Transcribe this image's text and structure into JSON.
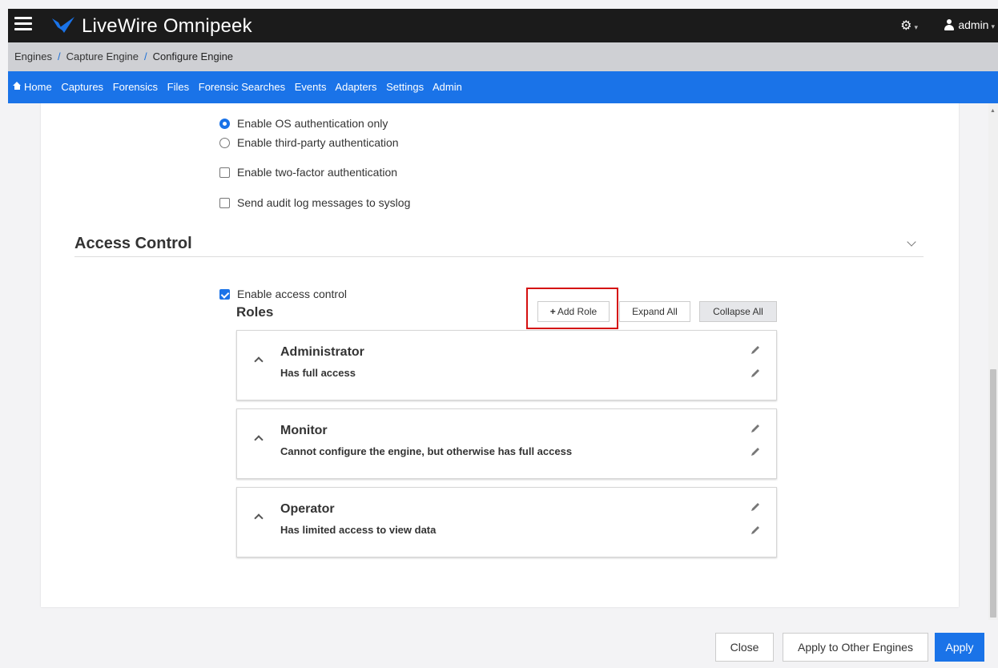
{
  "app": {
    "title": "LiveWire Omnipeek",
    "user": "admin"
  },
  "breadcrumb": [
    "Engines",
    "Capture Engine",
    "Configure Engine"
  ],
  "nav": [
    "Home",
    "Captures",
    "Forensics",
    "Files",
    "Forensic Searches",
    "Events",
    "Adapters",
    "Settings",
    "Admin"
  ],
  "auth": {
    "os_only": "Enable OS authentication only",
    "third_party": "Enable third-party authentication",
    "two_factor": "Enable two-factor authentication",
    "syslog": "Send audit log messages to syslog"
  },
  "access_control": {
    "title": "Access Control",
    "enable_label": "Enable access control",
    "roles_title": "Roles",
    "add_role": "Add Role",
    "expand_all": "Expand All",
    "collapse_all": "Collapse All",
    "roles": [
      {
        "name": "Administrator",
        "description": "Has full access"
      },
      {
        "name": "Monitor",
        "description": "Cannot configure the engine, but otherwise has full access"
      },
      {
        "name": "Operator",
        "description": "Has limited access to view data"
      }
    ]
  },
  "footer": {
    "close": "Close",
    "apply_other": "Apply to Other Engines",
    "apply": "Apply"
  },
  "icons": [
    "hamburger-icon",
    "logo-icon",
    "gear-icon",
    "user-icon",
    "home-icon",
    "plus-icon",
    "chevron-down-icon",
    "chevron-up-icon",
    "pencil-icon"
  ],
  "colors": {
    "primary": "#1a73e8",
    "topbar": "#1b1b1b",
    "highlight": "#d51010"
  }
}
